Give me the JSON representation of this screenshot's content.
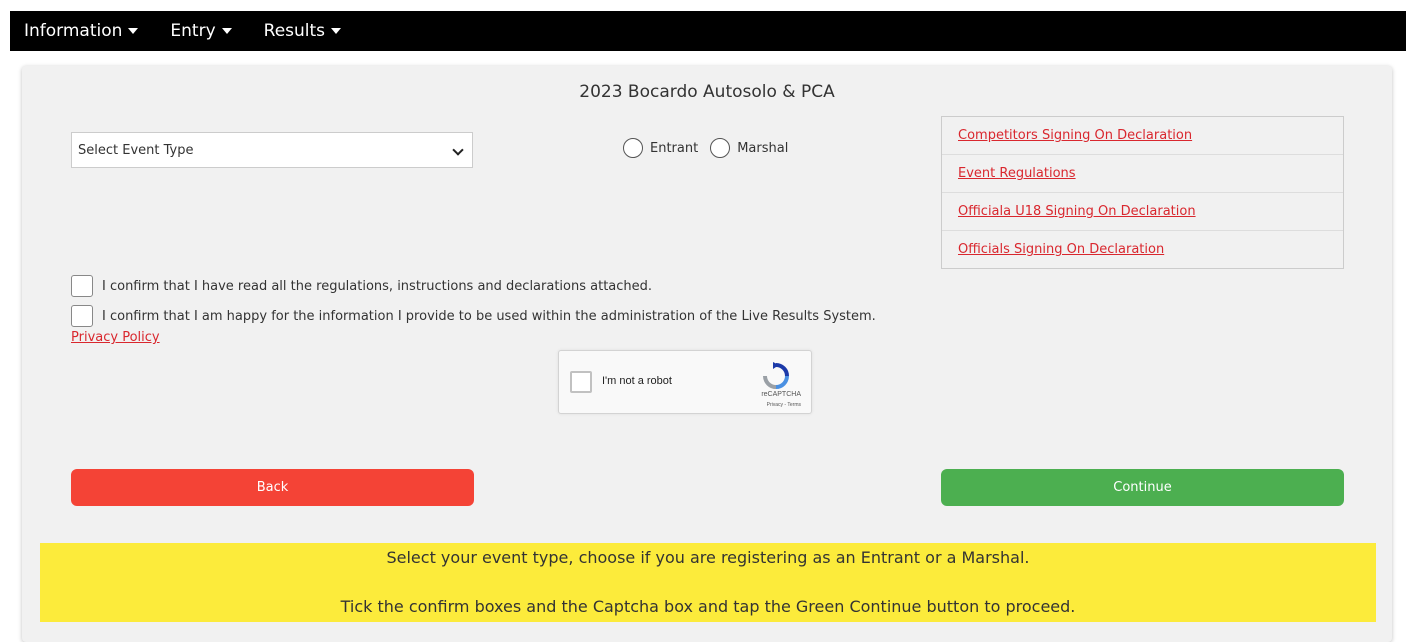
{
  "nav": {
    "items": [
      {
        "label": "Information"
      },
      {
        "label": "Entry"
      },
      {
        "label": "Results"
      }
    ]
  },
  "page": {
    "title": "2023 Bocardo Autosolo & PCA"
  },
  "form": {
    "event_type_select": {
      "selected": "Select Event Type"
    },
    "registration_type": {
      "options": [
        {
          "label": "Entrant",
          "checked": false
        },
        {
          "label": "Marshal",
          "checked": false
        }
      ]
    },
    "confirm_regulations": {
      "label": "I confirm that I have read all the regulations, instructions and declarations attached.",
      "checked": false
    },
    "confirm_data_use": {
      "label": "I confirm that I am happy for the information I provide to be used within the administration of the Live Results System.",
      "checked": false
    },
    "privacy_policy_link": "Privacy Policy"
  },
  "documents": [
    {
      "label": "Competitors Signing On Declaration"
    },
    {
      "label": "Event Regulations"
    },
    {
      "label": "Officiala U18 Signing On Declaration"
    },
    {
      "label": "Officials Signing On Declaration"
    }
  ],
  "captcha": {
    "label": "I'm not a robot",
    "brand": "reCAPTCHA",
    "terms": "Privacy - Terms"
  },
  "buttons": {
    "back": "Back",
    "continue": "Continue"
  },
  "notice": {
    "line1": "Select your event type, choose if you are registering as an Entrant or a Marshal.",
    "line2": "Tick the confirm boxes and the Captcha box and tap the Green Continue button to proceed."
  },
  "colors": {
    "nav_bg": "#000000",
    "link": "#d9272e",
    "back_button": "#f44336",
    "continue_button": "#4caf50",
    "notice_bg": "#fceb3b"
  }
}
